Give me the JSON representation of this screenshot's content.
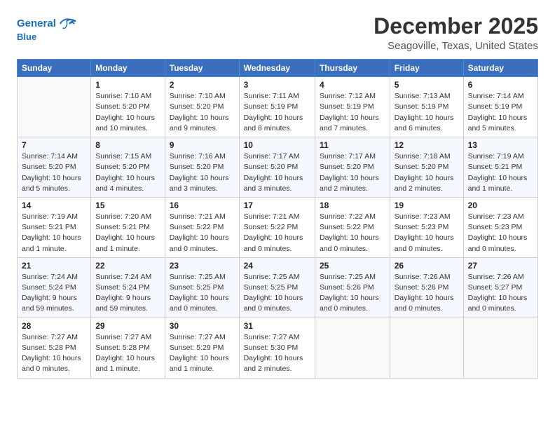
{
  "header": {
    "logo_line1": "General",
    "logo_line2": "Blue",
    "month": "December 2025",
    "location": "Seagoville, Texas, United States"
  },
  "days_of_week": [
    "Sunday",
    "Monday",
    "Tuesday",
    "Wednesday",
    "Thursday",
    "Friday",
    "Saturday"
  ],
  "weeks": [
    [
      {
        "day": "",
        "info": ""
      },
      {
        "day": "1",
        "info": "Sunrise: 7:10 AM\nSunset: 5:20 PM\nDaylight: 10 hours\nand 10 minutes."
      },
      {
        "day": "2",
        "info": "Sunrise: 7:10 AM\nSunset: 5:20 PM\nDaylight: 10 hours\nand 9 minutes."
      },
      {
        "day": "3",
        "info": "Sunrise: 7:11 AM\nSunset: 5:19 PM\nDaylight: 10 hours\nand 8 minutes."
      },
      {
        "day": "4",
        "info": "Sunrise: 7:12 AM\nSunset: 5:19 PM\nDaylight: 10 hours\nand 7 minutes."
      },
      {
        "day": "5",
        "info": "Sunrise: 7:13 AM\nSunset: 5:19 PM\nDaylight: 10 hours\nand 6 minutes."
      },
      {
        "day": "6",
        "info": "Sunrise: 7:14 AM\nSunset: 5:19 PM\nDaylight: 10 hours\nand 5 minutes."
      }
    ],
    [
      {
        "day": "7",
        "info": "Sunrise: 7:14 AM\nSunset: 5:20 PM\nDaylight: 10 hours\nand 5 minutes."
      },
      {
        "day": "8",
        "info": "Sunrise: 7:15 AM\nSunset: 5:20 PM\nDaylight: 10 hours\nand 4 minutes."
      },
      {
        "day": "9",
        "info": "Sunrise: 7:16 AM\nSunset: 5:20 PM\nDaylight: 10 hours\nand 3 minutes."
      },
      {
        "day": "10",
        "info": "Sunrise: 7:17 AM\nSunset: 5:20 PM\nDaylight: 10 hours\nand 3 minutes."
      },
      {
        "day": "11",
        "info": "Sunrise: 7:17 AM\nSunset: 5:20 PM\nDaylight: 10 hours\nand 2 minutes."
      },
      {
        "day": "12",
        "info": "Sunrise: 7:18 AM\nSunset: 5:20 PM\nDaylight: 10 hours\nand 2 minutes."
      },
      {
        "day": "13",
        "info": "Sunrise: 7:19 AM\nSunset: 5:21 PM\nDaylight: 10 hours\nand 1 minute."
      }
    ],
    [
      {
        "day": "14",
        "info": "Sunrise: 7:19 AM\nSunset: 5:21 PM\nDaylight: 10 hours\nand 1 minute."
      },
      {
        "day": "15",
        "info": "Sunrise: 7:20 AM\nSunset: 5:21 PM\nDaylight: 10 hours\nand 1 minute."
      },
      {
        "day": "16",
        "info": "Sunrise: 7:21 AM\nSunset: 5:22 PM\nDaylight: 10 hours\nand 0 minutes."
      },
      {
        "day": "17",
        "info": "Sunrise: 7:21 AM\nSunset: 5:22 PM\nDaylight: 10 hours\nand 0 minutes."
      },
      {
        "day": "18",
        "info": "Sunrise: 7:22 AM\nSunset: 5:22 PM\nDaylight: 10 hours\nand 0 minutes."
      },
      {
        "day": "19",
        "info": "Sunrise: 7:23 AM\nSunset: 5:23 PM\nDaylight: 10 hours\nand 0 minutes."
      },
      {
        "day": "20",
        "info": "Sunrise: 7:23 AM\nSunset: 5:23 PM\nDaylight: 10 hours\nand 0 minutes."
      }
    ],
    [
      {
        "day": "21",
        "info": "Sunrise: 7:24 AM\nSunset: 5:24 PM\nDaylight: 9 hours\nand 59 minutes."
      },
      {
        "day": "22",
        "info": "Sunrise: 7:24 AM\nSunset: 5:24 PM\nDaylight: 9 hours\nand 59 minutes."
      },
      {
        "day": "23",
        "info": "Sunrise: 7:25 AM\nSunset: 5:25 PM\nDaylight: 10 hours\nand 0 minutes."
      },
      {
        "day": "24",
        "info": "Sunrise: 7:25 AM\nSunset: 5:25 PM\nDaylight: 10 hours\nand 0 minutes."
      },
      {
        "day": "25",
        "info": "Sunrise: 7:25 AM\nSunset: 5:26 PM\nDaylight: 10 hours\nand 0 minutes."
      },
      {
        "day": "26",
        "info": "Sunrise: 7:26 AM\nSunset: 5:26 PM\nDaylight: 10 hours\nand 0 minutes."
      },
      {
        "day": "27",
        "info": "Sunrise: 7:26 AM\nSunset: 5:27 PM\nDaylight: 10 hours\nand 0 minutes."
      }
    ],
    [
      {
        "day": "28",
        "info": "Sunrise: 7:27 AM\nSunset: 5:28 PM\nDaylight: 10 hours\nand 0 minutes."
      },
      {
        "day": "29",
        "info": "Sunrise: 7:27 AM\nSunset: 5:28 PM\nDaylight: 10 hours\nand 1 minute."
      },
      {
        "day": "30",
        "info": "Sunrise: 7:27 AM\nSunset: 5:29 PM\nDaylight: 10 hours\nand 1 minute."
      },
      {
        "day": "31",
        "info": "Sunrise: 7:27 AM\nSunset: 5:30 PM\nDaylight: 10 hours\nand 2 minutes."
      },
      {
        "day": "",
        "info": ""
      },
      {
        "day": "",
        "info": ""
      },
      {
        "day": "",
        "info": ""
      }
    ]
  ]
}
